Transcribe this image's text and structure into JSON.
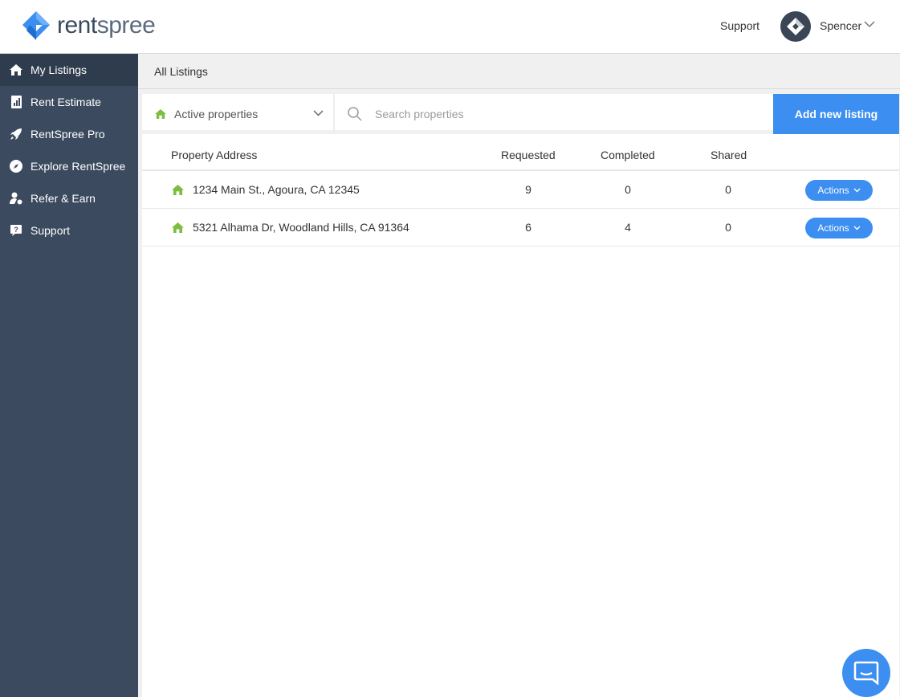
{
  "header": {
    "logo_part1": "rent",
    "logo_part2": "spree",
    "support_label": "Support",
    "user_name": "Spencer"
  },
  "sidebar": {
    "items": [
      {
        "label": "My Listings",
        "icon": "home-icon"
      },
      {
        "label": "Rent Estimate",
        "icon": "report-icon"
      },
      {
        "label": "RentSpree Pro",
        "icon": "rocket-icon"
      },
      {
        "label": "Explore RentSpree",
        "icon": "compass-icon"
      },
      {
        "label": "Refer & Earn",
        "icon": "refer-icon"
      },
      {
        "label": "Support",
        "icon": "help-icon"
      }
    ]
  },
  "breadcrumb": "All Listings",
  "filter": {
    "status_value": "Active properties",
    "search_placeholder": "Search properties",
    "add_label": "Add new listing"
  },
  "table": {
    "columns": [
      "Property Address",
      "Requested",
      "Completed",
      "Shared"
    ],
    "rows": [
      {
        "address": "1234 Main St., Agoura, CA 12345",
        "requested": "9",
        "completed": "0",
        "shared": "0",
        "action": "Actions"
      },
      {
        "address": "5321 Alhama Dr, Woodland Hills, CA 91364",
        "requested": "6",
        "completed": "4",
        "shared": "0",
        "action": "Actions"
      }
    ]
  },
  "colors": {
    "sidebar": "#3b4a5e",
    "accent": "#3c8ef0",
    "home_green": "#7cbd42"
  }
}
